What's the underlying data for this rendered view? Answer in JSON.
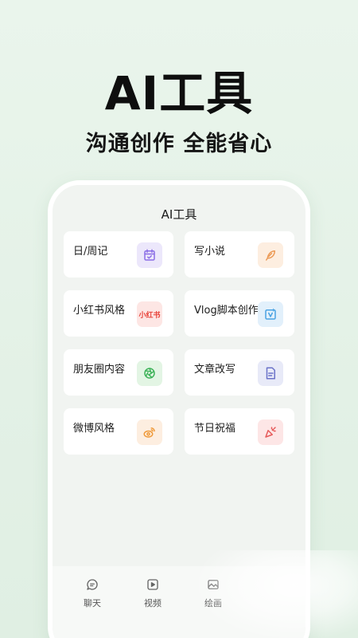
{
  "hero": {
    "title": "AI工具",
    "subtitle": "沟通创作 全能省心"
  },
  "screen": {
    "title": "AI工具"
  },
  "tools": [
    {
      "label": "日/周记",
      "icon": "calendar-check-icon",
      "bg": "#ece7fb",
      "color": "#8b6ee6"
    },
    {
      "label": "写小说",
      "icon": "feather-pen-icon",
      "bg": "#fdeee0",
      "color": "#ec9a55"
    },
    {
      "label": "小红书风格",
      "icon": "xiaohongshu-logo-icon",
      "badge": "小红书",
      "bg": "#fde6e4",
      "color": "#e8453c"
    },
    {
      "label": "Vlog脚本创作",
      "icon": "vlog-video-icon",
      "bg": "#e2f0fb",
      "color": "#4aa3e3"
    },
    {
      "label": "朋友圈内容",
      "icon": "moments-shutter-icon",
      "bg": "#e3f5e4",
      "color": "#3fb35a"
    },
    {
      "label": "文章改写",
      "icon": "document-icon",
      "bg": "#e8eaf8",
      "color": "#6b73c9"
    },
    {
      "label": "微博风格",
      "icon": "weibo-logo-icon",
      "bg": "#fdeee0",
      "color": "#ef9a3a"
    },
    {
      "label": "节日祝福",
      "icon": "party-popper-icon",
      "bg": "#fde6e6",
      "color": "#e65b5b"
    }
  ],
  "tabbar": [
    {
      "label": "聊天",
      "icon": "chat-bubble-icon"
    },
    {
      "label": "视频",
      "icon": "video-play-icon"
    },
    {
      "label": "绘画",
      "icon": "image-icon"
    }
  ]
}
